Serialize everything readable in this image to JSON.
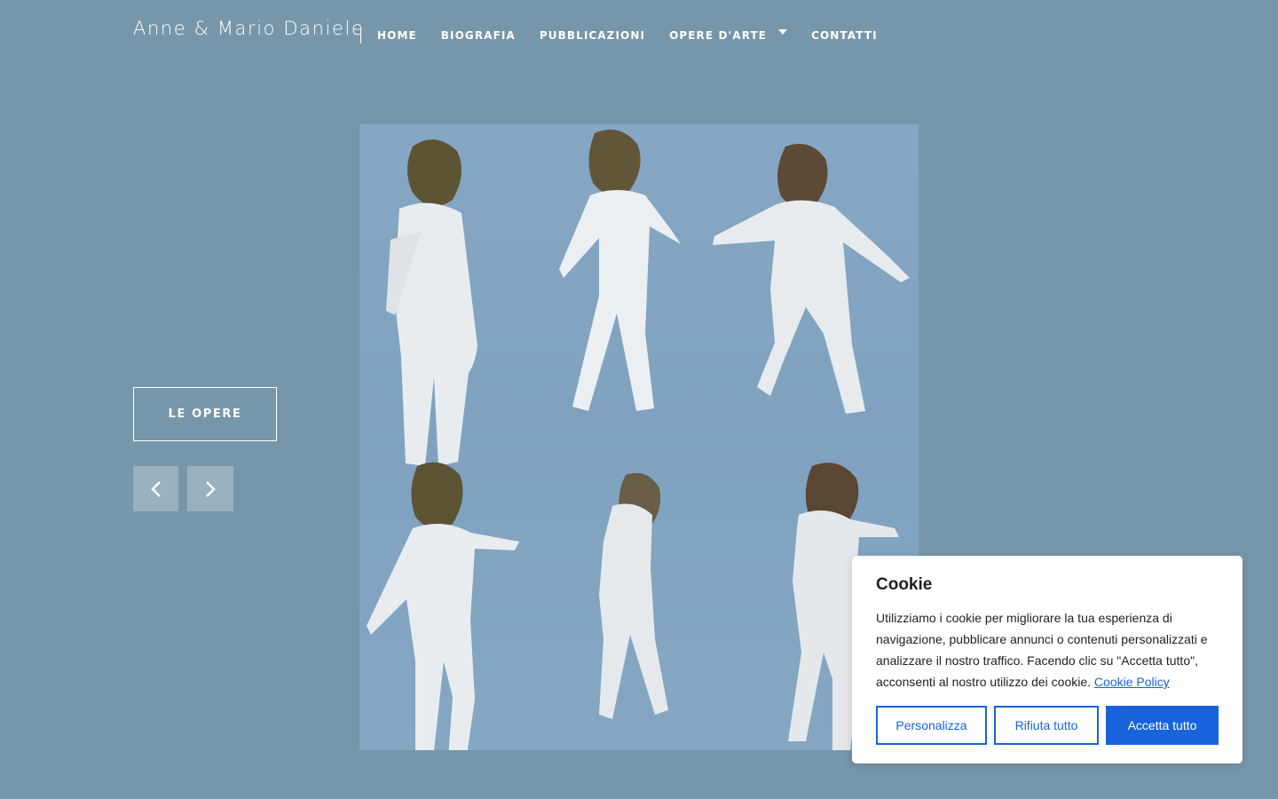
{
  "header": {
    "site_title": "Anne & Mario Daniele",
    "nav": [
      {
        "label": "HOME"
      },
      {
        "label": "BIOGRAFIA"
      },
      {
        "label": "PUBBLICAZIONI"
      },
      {
        "label": "OPERE D'ARTE",
        "has_dropdown": true
      },
      {
        "label": "CONTATTI"
      }
    ]
  },
  "hero": {
    "cta_label": "LE OPERE",
    "prev_icon": "chevron-left-icon",
    "next_icon": "chevron-right-icon"
  },
  "cookie_banner": {
    "title": "Cookie",
    "text": "Utilizziamo i cookie per migliorare la tua esperienza di navigazione, pubblicare annunci o contenuti personalizzati e analizzare il nostro traffico. Facendo clic su \"Accetta tutto\", acconsenti al nostro utilizzo dei cookie.",
    "policy_link": "Cookie Policy",
    "buttons": {
      "customize": "Personalizza",
      "reject": "Rifiuta tutto",
      "accept": "Accetta tutto"
    }
  },
  "colors": {
    "background": "#7796a9",
    "accent": "#1863dc"
  }
}
